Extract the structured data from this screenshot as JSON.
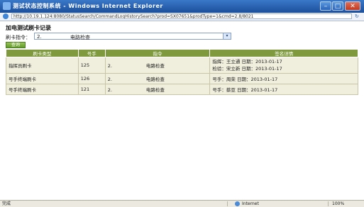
{
  "window": {
    "title": "测试状态控制系统 - Windows Internet Explorer",
    "minimize": "–",
    "maximize": "□",
    "close": "✕"
  },
  "address": {
    "url": "http://10.19.1.124:8080/StatusSearch/CommandLogHistorySearch?prod=SX07651&prodType=1&cmd=2.8/8021"
  },
  "page": {
    "title": "加电测试刷卡记录"
  },
  "filter": {
    "label": "刷卡指令：",
    "code": "2.",
    "name": "电路检查",
    "query_button": "查询"
  },
  "table": {
    "headers": [
      "刷卡类型",
      "号手",
      "指令",
      "签名详情"
    ],
    "rows": [
      {
        "type": "指挥员刷卡",
        "num": "125",
        "code": "2.",
        "name": "电路检查",
        "sig1": "指挥：王立通 日期：2013-01-17",
        "sig2": "检验：宋立新 日期：2013-01-17"
      },
      {
        "type": "号手终端刷卡",
        "num": "126",
        "code": "2.",
        "name": "电路检查",
        "sig1": "号手：周荣 日期：2013-01-17",
        "sig2": ""
      },
      {
        "type": "号手终端刷卡",
        "num": "121",
        "code": "2.",
        "name": "电路检查",
        "sig1": "号手：蔡亚 日期：2013-01-17",
        "sig2": ""
      }
    ]
  },
  "status": {
    "left": "完成",
    "zone": "Internet",
    "zoom": "100%"
  }
}
